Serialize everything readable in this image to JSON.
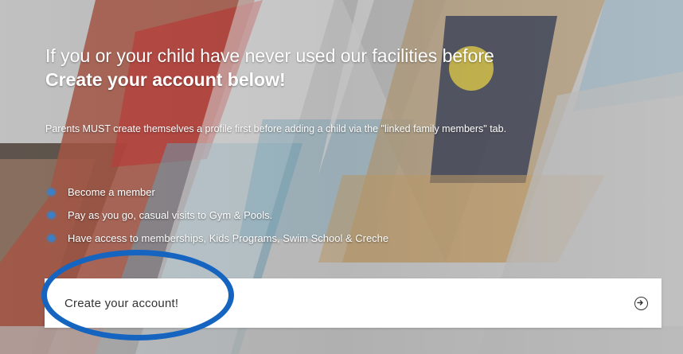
{
  "hero": {
    "heading_line1": "If you or your child have never used our facilities before",
    "heading_line2": "Create your account below!",
    "parent_note": "Parents MUST create themselves a profile first before adding a child via the \"linked family members\" tab."
  },
  "benefits": [
    {
      "label": "Become a member",
      "icon": "bullet-dot-icon"
    },
    {
      "label": "Pay as you go, casual visits to Gym & Pools.",
      "icon": "bullet-dot-icon"
    },
    {
      "label": "Have access to memberships, Kids Programs, Swim School & Creche",
      "icon": "bullet-dot-icon"
    }
  ],
  "cta": {
    "label": "Create your account!",
    "icon": "arrow-right-circle-icon"
  },
  "annotation": {
    "shape": "ellipse",
    "color": "#1565c0",
    "target": "cta"
  },
  "colors": {
    "accent": "#3b7fc4",
    "text_on_image": "#ffffff",
    "button_bg": "#ffffff",
    "annotation": "#1565c0"
  }
}
